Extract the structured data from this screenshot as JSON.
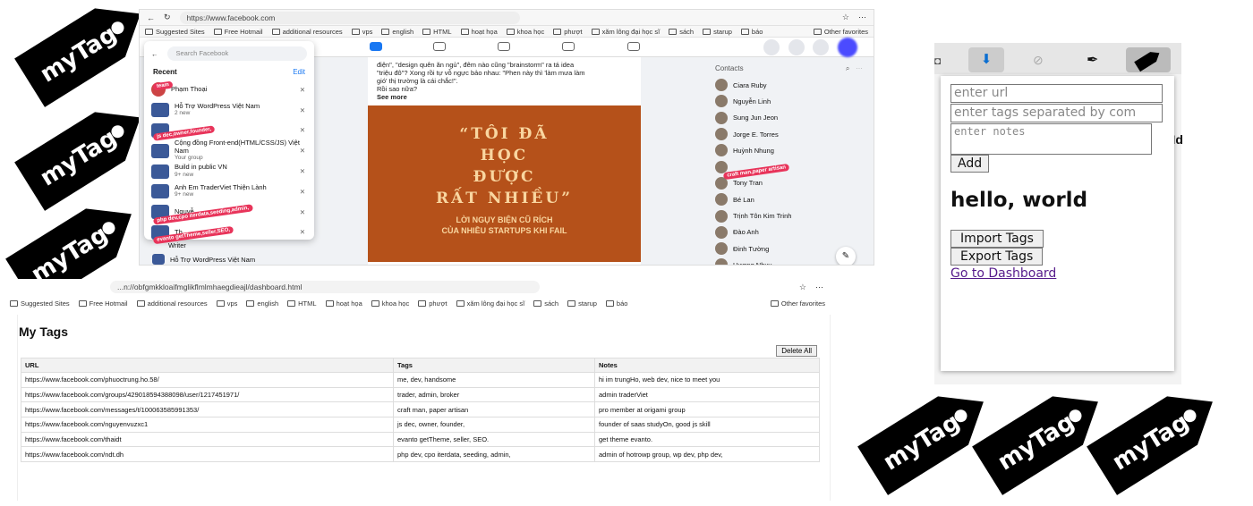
{
  "tag_label": "myTag",
  "facebook": {
    "address": "https://www.facebook.com",
    "favorites": [
      "Suggested Sites",
      "Free Hotmail",
      "additional resources",
      "vps",
      "english",
      "HTML",
      "hoạt họa",
      "khoa học",
      "phượt",
      "xăm lông đại học sĩ",
      "sách",
      "starup",
      "báo"
    ],
    "other_favorites": "Other favorites",
    "search_placeholder": "Search Facebook",
    "recent_label": "Recent",
    "edit_label": "Edit",
    "recent_items": [
      {
        "name": "Phạm Thoại",
        "sub": "",
        "stamp": "team"
      },
      {
        "name": "Hỗ Trợ WordPress Việt Nam",
        "sub": "2 new",
        "stamp": ""
      },
      {
        "name": "",
        "sub": "",
        "stamp": "js dec,owner,founder,"
      },
      {
        "name": "Cộng đồng Front-end(HTML/CSS/JS) Việt Nam",
        "sub": "Your group",
        "stamp": ""
      },
      {
        "name": "Build in public VN",
        "sub": "9+ new",
        "stamp": ""
      },
      {
        "name": "Anh Em TraderViet Thiện Lành",
        "sub": "9+ new",
        "stamp": ""
      },
      {
        "name": "Nguyễ...",
        "sub": "",
        "stamp": "php dev,cpo iterdata,seeding,admin,"
      },
      {
        "name": "Th...",
        "sub": "",
        "stamp": "evanto getTheme,seller,SEO,"
      }
    ],
    "left_below": [
      "Writer",
      "Hỗ Trợ WordPress Việt Nam"
    ],
    "feed_lines": [
      "điện\", \"design quên ăn ngủ\", đêm nào cũng \"brainstorm\" ra tá idea",
      "\"triệu đô\"? Xong rồi tự vỗ ngực bảo nhau: \"Phen này thì 'làm mưa làm",
      "gió' thị trường là cái chắc!\".",
      "Rồi sao nữa?",
      "See more"
    ],
    "poster_big": [
      "“TÔI ĐÃ",
      "HỌC",
      "ĐƯỢC",
      "RẤT NHIỀU”"
    ],
    "poster_small": [
      "LỜI NGỤY BIỆN CŨ RÍCH",
      "CỦA NHIỀU STARTUPS KHI FAIL"
    ],
    "contacts_label": "Contacts",
    "contacts": [
      "Ciara Ruby",
      "Nguyễn Linh",
      "Sung Jun Jeon",
      "Jorge E. Torres",
      "Huỳnh Nhung",
      "",
      "Tony Tran",
      "Bé Lan",
      "Trịnh Tôn Kim Trinh",
      "Đào Anh",
      "Đinh Tường",
      "Hương Nhụy"
    ],
    "contact_stamp": "craft man,paper artisan"
  },
  "dashboard": {
    "address": "...n://obfgmkkloaifmglikflmlmhaegdieajl/dashboard.html",
    "favorites": [
      "Suggested Sites",
      "Free Hotmail",
      "additional resources",
      "vps",
      "english",
      "HTML",
      "hoạt họa",
      "khoa học",
      "phượt",
      "xăm lông đại học sĩ",
      "sách",
      "starup",
      "báo"
    ],
    "other_favorites": "Other favorites",
    "title": "My Tags",
    "delete_all": "Delete All",
    "columns": [
      "URL",
      "Tags",
      "Notes"
    ],
    "rows": [
      [
        "https://www.facebook.com/phuoctrung.ho.58/",
        "me, dev, handsome",
        "hi im trungHo, web dev, nice to meet you"
      ],
      [
        "https://www.facebook.com/groups/429018594388098/user/1217451971/",
        "trader, admin, broker",
        "admin traderViet"
      ],
      [
        "https://www.facebook.com/messages/t/100063585991353/",
        "craft man, paper artisan",
        "pro member at origami group"
      ],
      [
        "https://www.facebook.com/nguyenvuzxc1",
        "js dec, owner, founder,",
        "founder of saas studyOn, good js skill"
      ],
      [
        "https://www.facebook.com/thaidt",
        "evanto getTheme, seller, SEO.",
        "get theme evanto."
      ],
      [
        "https://www.facebook.com/ndt.dh",
        "php dev, cpo iterdata, seeding, admin,",
        "admin of hotrowp group, wp dev, php dev,"
      ]
    ]
  },
  "popup": {
    "url_placeholder": "enter url",
    "tags_placeholder": "enter tags separated by com",
    "notes_placeholder": "enter notes",
    "add_label": "Add",
    "greeting": "hello, world",
    "import_label": "Import Tags",
    "export_label": "Export Tags",
    "dashboard_link": "Go to Dashboard"
  }
}
